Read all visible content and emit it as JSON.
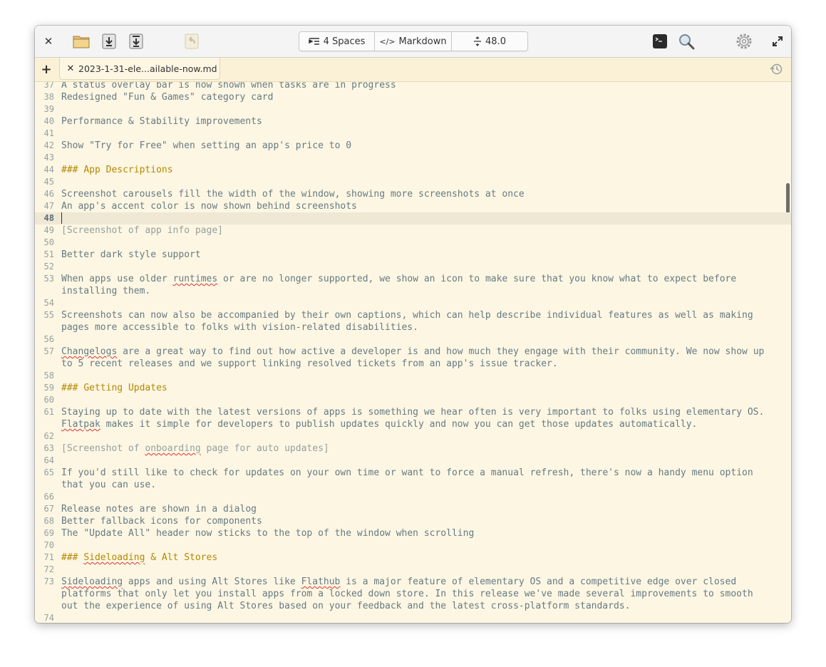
{
  "toolbar": {
    "indent_label": "4 Spaces",
    "language_label": "Markdown",
    "font_size_label": "48.0"
  },
  "tabs": [
    {
      "label": "2023-1-31-ele...ailable-now.md"
    }
  ],
  "editor": {
    "current_line": 48,
    "lines": [
      {
        "n": "37",
        "text": "A status overlay bar is now shown when tasks are in progress"
      },
      {
        "n": "38",
        "text": "Redesigned \"Fun & Games\" category card"
      },
      {
        "n": "39",
        "text": ""
      },
      {
        "n": "40",
        "text": "Performance & Stability improvements"
      },
      {
        "n": "41",
        "text": ""
      },
      {
        "n": "42",
        "text": "Show \"Try for Free\" when setting an app's price to 0"
      },
      {
        "n": "43",
        "text": ""
      },
      {
        "n": "44",
        "text": "### App Descriptions",
        "style": "heading"
      },
      {
        "n": "45",
        "text": ""
      },
      {
        "n": "46",
        "text": "Screenshot carousels fill the width of the window, showing more screenshots at once"
      },
      {
        "n": "47",
        "text": "An app's accent color is now shown behind screenshots"
      },
      {
        "n": "48",
        "text": ""
      },
      {
        "n": "49",
        "text": "[Screenshot of app info page]",
        "style": "link"
      },
      {
        "n": "50",
        "text": ""
      },
      {
        "n": "51",
        "text": "Better dark style support"
      },
      {
        "n": "52",
        "text": ""
      },
      {
        "n": "53",
        "text": "When apps use older runtimes or are no longer supported, we show an icon to make sure that you know what to expect before"
      },
      {
        "n": "",
        "text": "installing them."
      },
      {
        "n": "54",
        "text": ""
      },
      {
        "n": "55",
        "text": "Screenshots can now also be accompanied by their own captions, which can help describe individual features as well as making"
      },
      {
        "n": "",
        "text": "pages more accessible to folks with vision-related disabilities."
      },
      {
        "n": "56",
        "text": ""
      },
      {
        "n": "57",
        "text": "Changelogs are a great way to find out how active a developer is and how much they engage with their community. We now show up"
      },
      {
        "n": "",
        "text": "to 5 recent releases and we support linking resolved tickets from an app's issue tracker."
      },
      {
        "n": "58",
        "text": ""
      },
      {
        "n": "59",
        "text": "### Getting Updates",
        "style": "heading"
      },
      {
        "n": "60",
        "text": ""
      },
      {
        "n": "61",
        "text": "Staying up to date with the latest versions of apps is something we hear often is very important to folks using elementary OS."
      },
      {
        "n": "",
        "text": "Flatpak makes it simple for developers to publish updates quickly and now you can get those updates automatically."
      },
      {
        "n": "62",
        "text": ""
      },
      {
        "n": "63",
        "text": "[Screenshot of onboarding page for auto updates]",
        "style": "link"
      },
      {
        "n": "64",
        "text": ""
      },
      {
        "n": "65",
        "text": "If you'd still like to check for updates on your own time or want to force a manual refresh, there's now a handy menu option"
      },
      {
        "n": "",
        "text": "that you can use."
      },
      {
        "n": "66",
        "text": ""
      },
      {
        "n": "67",
        "text": "Release notes are shown in a dialog"
      },
      {
        "n": "68",
        "text": "Better fallback icons for components"
      },
      {
        "n": "69",
        "text": "The \"Update All\" header now sticks to the top of the window when scrolling"
      },
      {
        "n": "70",
        "text": ""
      },
      {
        "n": "71",
        "text": "### Sideloading & Alt Stores",
        "style": "heading"
      },
      {
        "n": "72",
        "text": ""
      },
      {
        "n": "73",
        "text": "Sideloading apps and using Alt Stores like Flathub is a major feature of elementary OS and a competitive edge over closed"
      },
      {
        "n": "",
        "text": "platforms that only let you install apps from a locked down store. In this release we've made several improvements to smooth"
      },
      {
        "n": "",
        "text": "out the experience of using Alt Stores based on your feedback and the latest cross-platform standards."
      },
      {
        "n": "74",
        "text": ""
      }
    ],
    "misspelled": [
      "runtimes",
      "Changelogs",
      "Flatpak",
      "onboarding",
      "Sideloading",
      "Flathub"
    ]
  },
  "icons": {
    "close": "close-icon",
    "open": "folder-icon",
    "save": "save-icon",
    "save_as": "save-as-icon",
    "revert": "revert-icon",
    "indent": "indent-icon",
    "language": "code-icon",
    "font_size": "font-size-icon",
    "terminal": "terminal-icon",
    "search": "search-icon",
    "settings": "gear-icon",
    "fullscreen": "fullscreen-icon",
    "new_tab": "plus-icon",
    "history": "history-icon"
  },
  "colors": {
    "background": "#fdf6e3",
    "text": "#657b83",
    "heading": "#b58900",
    "line_number": "#93a1a1",
    "current_line": "#eee8d5"
  }
}
